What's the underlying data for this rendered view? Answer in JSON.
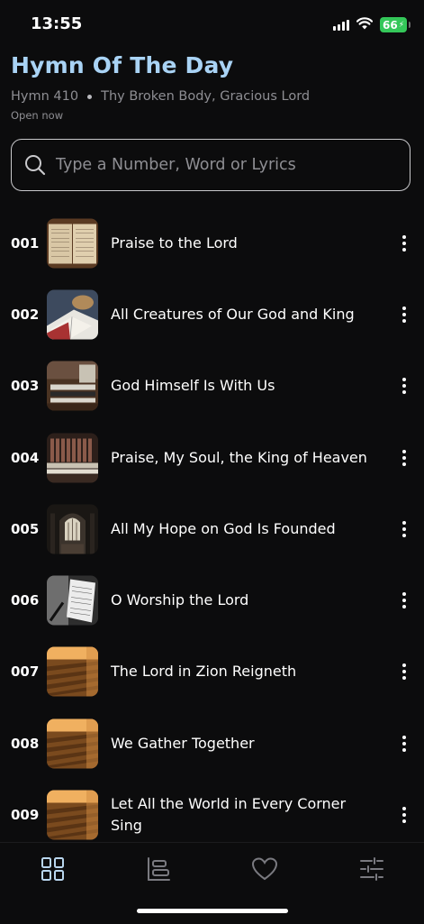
{
  "status": {
    "time": "13:55",
    "battery": "66"
  },
  "header": {
    "title": "Hymn Of The Day",
    "hymn_number": "Hymn 410",
    "hymn_name": "Thy Broken Body, Gracious Lord",
    "open_now": "Open now"
  },
  "search": {
    "placeholder": "Type a Number, Word or Lyrics"
  },
  "hymns": [
    {
      "number": "001",
      "title": "Praise to the Lord",
      "thumb": "sheet-music"
    },
    {
      "number": "002",
      "title": "All Creatures of Our God and King",
      "thumb": "hymnal-book"
    },
    {
      "number": "003",
      "title": "God Himself Is With Us",
      "thumb": "church-organ"
    },
    {
      "number": "004",
      "title": "Praise, My Soul, the King of Heaven",
      "thumb": "organ-pipes"
    },
    {
      "number": "005",
      "title": "All My Hope on God Is Founded",
      "thumb": "cathedral-nave"
    },
    {
      "number": "006",
      "title": "O Worship the Lord",
      "thumb": "music-stand"
    },
    {
      "number": "007",
      "title": "The Lord in Zion Reigneth",
      "thumb": "church-pews"
    },
    {
      "number": "008",
      "title": "We Gather Together",
      "thumb": "church-pews"
    },
    {
      "number": "009",
      "title": "Let All the World in Every Corner Sing",
      "thumb": "church-pews"
    }
  ],
  "tabbar": {
    "tabs": [
      {
        "name": "tab-home",
        "icon": "grid-icon"
      },
      {
        "name": "tab-categories",
        "icon": "categories-icon"
      },
      {
        "name": "tab-favorites",
        "icon": "heart-icon"
      },
      {
        "name": "tab-settings",
        "icon": "sliders-icon"
      }
    ]
  },
  "colors": {
    "background": "#0c0c0d",
    "title": "#a9d3f5",
    "muted": "#8e8e93",
    "battery": "#34c759"
  }
}
